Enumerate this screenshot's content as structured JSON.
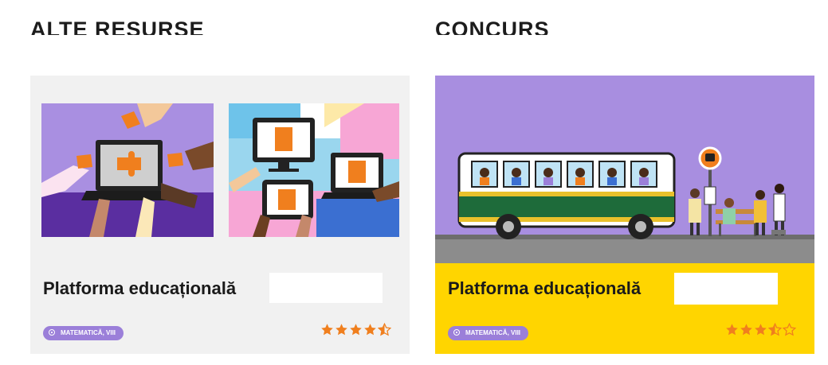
{
  "sections": {
    "left_title": "ALTE RESURSE",
    "right_title": "CONCURS"
  },
  "cards": [
    {
      "title": "Platforma educațională",
      "tag": "MATEMATICĂ, VIII",
      "rating": 4.5,
      "rating_max": 5,
      "background": "#f1f1f1",
      "accent": "#f07f1e"
    },
    {
      "title": "Platforma educațională",
      "tag": "MATEMATICĂ, VIII",
      "rating": 3.5,
      "rating_max": 5,
      "background": "#ffd500",
      "accent": "#f07f1e"
    }
  ],
  "colors": {
    "tag_purple": "#9b7fd9",
    "sky_purple": "#a88ee0",
    "bus_green": "#1e6b3a",
    "star_orange": "#f07f1e"
  },
  "icons": [
    "star-icon",
    "half-star-icon",
    "empty-star-icon",
    "bus-stop-icon",
    "tag-info-icon"
  ]
}
